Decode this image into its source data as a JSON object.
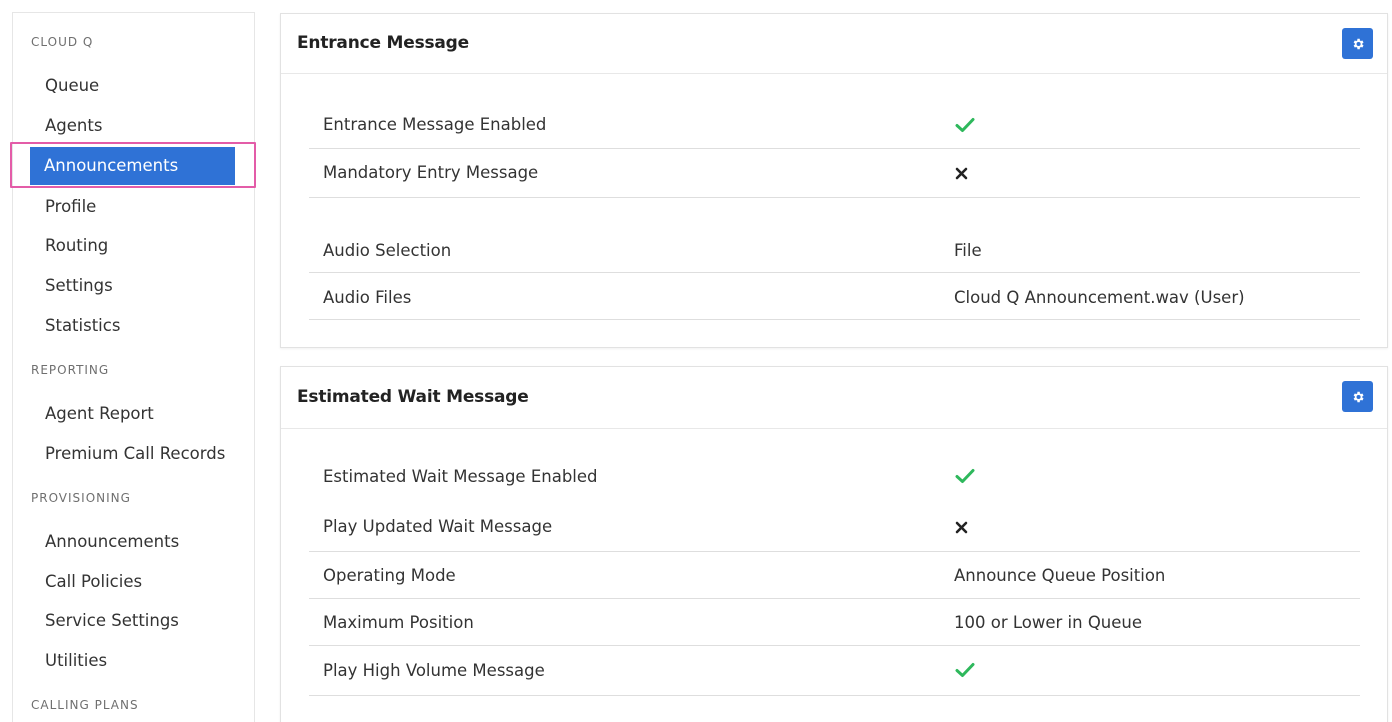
{
  "sidebar": {
    "sections": [
      {
        "title": "CLOUD Q"
      },
      {
        "title": "REPORTING"
      },
      {
        "title": "PROVISIONING"
      },
      {
        "title": "CALLING PLANS"
      }
    ],
    "cloud_q_items": [
      "Queue",
      "Agents",
      "Announcements",
      "Profile",
      "Routing",
      "Settings",
      "Statistics"
    ],
    "reporting_items": [
      "Agent Report",
      "Premium Call Records"
    ],
    "provisioning_items": [
      "Announcements",
      "Call Policies",
      "Service Settings",
      "Utilities"
    ],
    "active_item": "Announcements"
  },
  "entrance_panel": {
    "title": "Entrance Message",
    "rows": [
      {
        "label": "Entrance Message Enabled",
        "value": true
      },
      {
        "label": "Mandatory Entry Message",
        "value": false
      },
      {
        "label": "Audio Selection",
        "value": "File"
      },
      {
        "label": "Audio Files",
        "value": "Cloud Q Announcement.wav (User)"
      }
    ]
  },
  "wait_panel": {
    "title": "Estimated Wait Message",
    "rows": [
      {
        "label": "Estimated Wait Message Enabled",
        "value": true
      },
      {
        "label": "Play Updated Wait Message",
        "value": false
      },
      {
        "label": "Operating Mode",
        "value": "Announce Queue Position"
      },
      {
        "label": "Maximum Position",
        "value": "100 or Lower in Queue"
      },
      {
        "label": "Play High Volume Message",
        "value": true
      }
    ]
  },
  "icons": {
    "gear": "gear-icon",
    "check": "checkmark-icon",
    "cross": "cross-icon"
  },
  "colors": {
    "accent": "#2f72d6",
    "highlight": "#e35ca8",
    "check": "#2eb85c"
  }
}
